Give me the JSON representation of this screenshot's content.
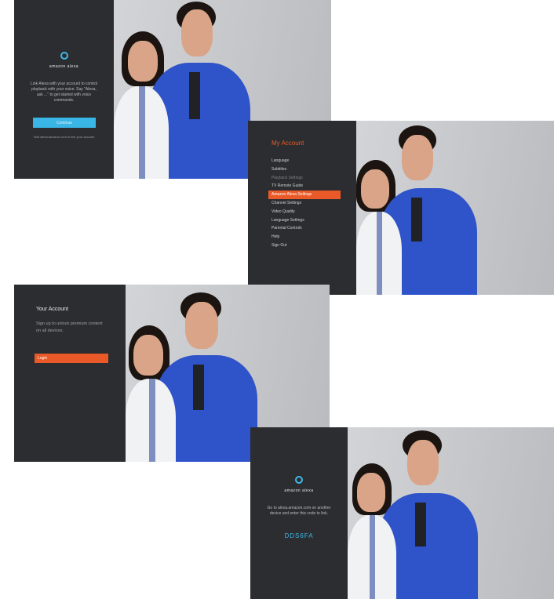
{
  "panels": {
    "signin": {
      "brand": "amazon alexa",
      "description": "Link Alexa with your account to control playback with your voice. Say \"Alexa, ask ...\" to get started with voice commands.",
      "button_label": "Continue",
      "footer": "Visit alexa.amazon.com to link your account"
    },
    "settings": {
      "title": "My Account",
      "items": [
        {
          "label": "Language"
        },
        {
          "label": "Subtitles"
        },
        {
          "label": "Playback Settings"
        },
        {
          "label": "TV Remote Guide"
        },
        {
          "label": "Amazon Alexa Settings"
        },
        {
          "label": "Channel Settings"
        },
        {
          "label": "Video Quality"
        },
        {
          "label": "Language Settings"
        },
        {
          "label": "Parental Controls"
        },
        {
          "label": "Help"
        },
        {
          "label": "Sign Out"
        }
      ]
    },
    "account": {
      "title": "Your Account",
      "text": "Sign up to unlock premium content on all devices.",
      "button_label": "Login"
    },
    "code": {
      "brand": "amazon alexa",
      "description": "Go to alexa.amazon.com on another device and enter this code to link.",
      "code_value": "DDS6FA"
    }
  },
  "colors": {
    "sidebar": "#2b2d30",
    "accent_blue": "#39b5e6",
    "accent_orange": "#ea5a28"
  }
}
